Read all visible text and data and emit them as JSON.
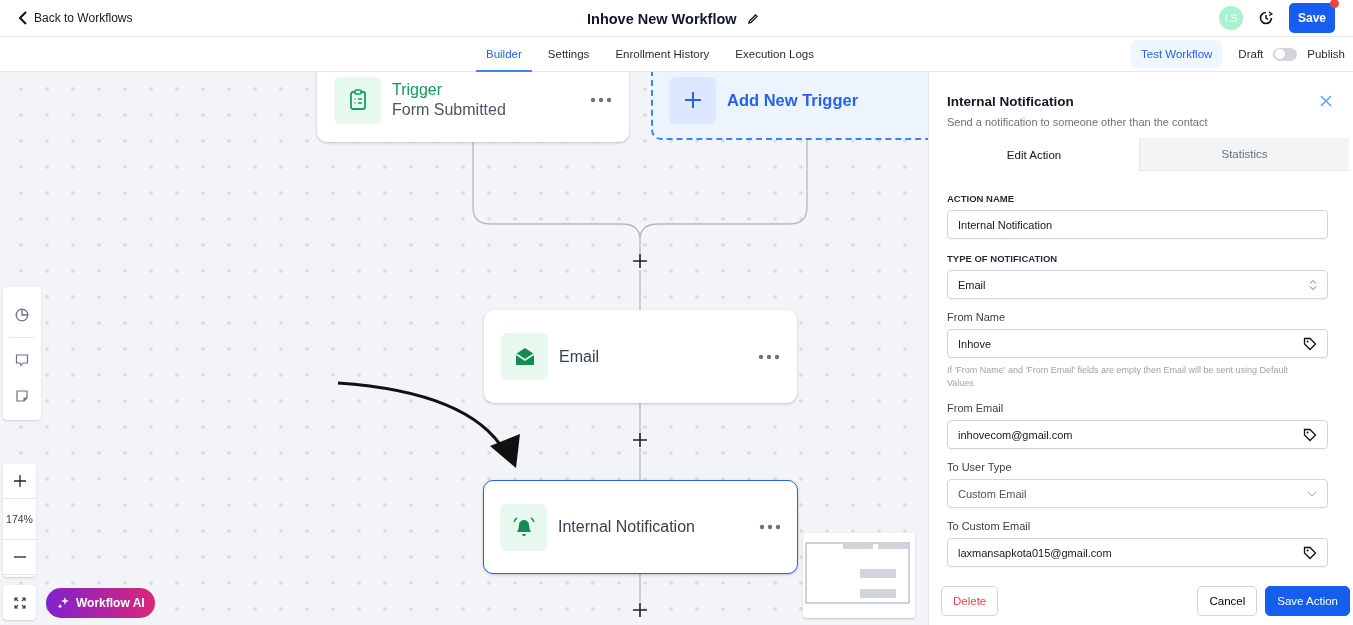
{
  "header": {
    "back": "Back to Workflows",
    "title": "Inhove New Workflow",
    "avatar": "LS",
    "save": "Save",
    "save_notification": true
  },
  "nav": {
    "tabs": [
      {
        "label": "Builder",
        "selected": true
      },
      {
        "label": "Settings",
        "selected": false
      },
      {
        "label": "Enrollment History",
        "selected": false
      },
      {
        "label": "Execution Logs",
        "selected": false
      }
    ],
    "test_button": "Test Workflow",
    "draft_label": "Draft",
    "publish_toggle": {
      "on": false
    },
    "publish_label": "Publish"
  },
  "canvas": {
    "nodes": [
      {
        "kind": "trigger",
        "title": "Trigger",
        "subtitle": "Form Submitted",
        "selected": false
      },
      {
        "kind": "add_trigger",
        "title": "Add New Trigger"
      },
      {
        "kind": "email",
        "title": "Email",
        "selected": false
      },
      {
        "kind": "notification",
        "title": "Internal Notification",
        "selected": true
      }
    ],
    "zoom": "174%",
    "ai_button": "Workflow AI"
  },
  "panel": {
    "title": "Internal Notification",
    "subtitle": "Send a notification to someone other than the contact",
    "tabs": [
      {
        "label": "Edit Action",
        "selected": true
      },
      {
        "label": "Statistics",
        "selected": false
      }
    ],
    "fields": [
      {
        "kind": "text",
        "label": "ACTION NAME",
        "caps": true,
        "value": "Internal Notification"
      },
      {
        "kind": "stepper",
        "label": "TYPE OF NOTIFICATION",
        "caps": true,
        "value": "Email"
      },
      {
        "kind": "tagged",
        "label": "From Name",
        "caps": false,
        "value": "Inhove",
        "hint": "If 'From Name' and 'From Email' fields are empty then Email will be sent using Default Values"
      },
      {
        "kind": "tagged",
        "label": "From Email",
        "caps": false,
        "value": "inhovecom@gmail.com"
      },
      {
        "kind": "dropdown",
        "label": "To User Type",
        "caps": false,
        "value": "Custom Email"
      },
      {
        "kind": "tagged",
        "label": "To Custom Email",
        "caps": false,
        "value": "laxmansapkota015@gmail.com"
      }
    ],
    "delete": "Delete",
    "cancel": "Cancel",
    "save": "Save Action"
  }
}
